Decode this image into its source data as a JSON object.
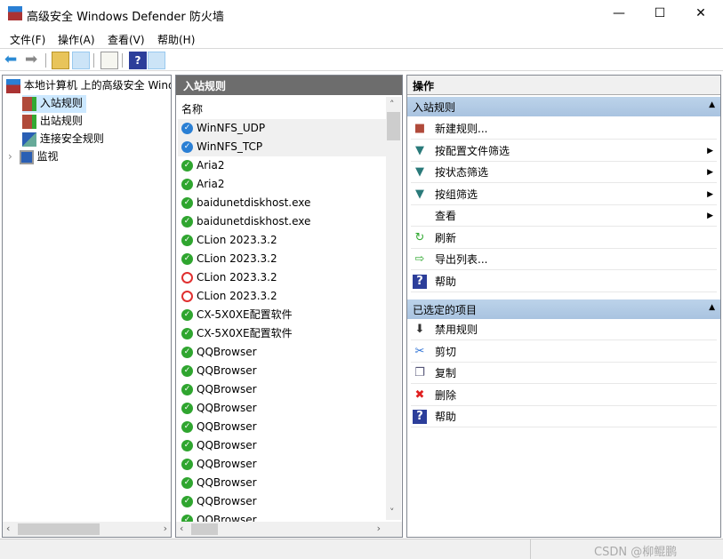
{
  "window": {
    "title": "高级安全 Windows Defender 防火墙",
    "minimize": "—",
    "maximize": "☐",
    "close": "✕"
  },
  "menu": [
    "文件(F)",
    "操作(A)",
    "查看(V)",
    "帮助(H)"
  ],
  "tree": {
    "root": "本地计算机 上的高级安全 Windows Defender 防火墙",
    "items": [
      "入站规则",
      "出站规则",
      "连接安全规则",
      "监视"
    ]
  },
  "middle": {
    "title": "入站规则",
    "column": "名称",
    "rows": [
      {
        "name": "WinNFS_UDP",
        "status": "enabled-shared"
      },
      {
        "name": "WinNFS_TCP",
        "status": "enabled-shared"
      },
      {
        "name": "Aria2",
        "status": "allow"
      },
      {
        "name": "Aria2",
        "status": "allow"
      },
      {
        "name": "baidunetdiskhost.exe",
        "status": "allow"
      },
      {
        "name": "baidunetdiskhost.exe",
        "status": "allow"
      },
      {
        "name": "CLion 2023.3.2",
        "status": "allow"
      },
      {
        "name": "CLion 2023.3.2",
        "status": "allow"
      },
      {
        "name": "CLion 2023.3.2",
        "status": "block"
      },
      {
        "name": "CLion 2023.3.2",
        "status": "block"
      },
      {
        "name": "CX-5X0XE配置软件",
        "status": "allow"
      },
      {
        "name": "CX-5X0XE配置软件",
        "status": "allow"
      },
      {
        "name": "QQBrowser",
        "status": "allow"
      },
      {
        "name": "QQBrowser",
        "status": "allow"
      },
      {
        "name": "QQBrowser",
        "status": "allow"
      },
      {
        "name": "QQBrowser",
        "status": "allow"
      },
      {
        "name": "QQBrowser",
        "status": "allow"
      },
      {
        "name": "QQBrowser",
        "status": "allow"
      },
      {
        "name": "QQBrowser",
        "status": "allow"
      },
      {
        "name": "QQBrowser",
        "status": "allow"
      },
      {
        "name": "QQBrowser",
        "status": "allow"
      },
      {
        "name": "QQBrowser",
        "status": "allow"
      }
    ]
  },
  "actions": {
    "title": "操作",
    "section1": {
      "title": "入站规则",
      "items": [
        {
          "label": "新建规则...",
          "icon": "new-rule-icon",
          "sub": false
        },
        {
          "label": "按配置文件筛选",
          "icon": "filter-icon",
          "sub": true
        },
        {
          "label": "按状态筛选",
          "icon": "filter-icon",
          "sub": true
        },
        {
          "label": "按组筛选",
          "icon": "filter-icon",
          "sub": true
        },
        {
          "label": "查看",
          "icon": "",
          "sub": true
        },
        {
          "label": "刷新",
          "icon": "refresh-icon",
          "sub": false
        },
        {
          "label": "导出列表...",
          "icon": "export-icon",
          "sub": false
        },
        {
          "label": "帮助",
          "icon": "help-icon",
          "sub": false
        }
      ]
    },
    "section2": {
      "title": "已选定的项目",
      "items": [
        {
          "label": "禁用规则",
          "icon": "disable-icon"
        },
        {
          "label": "剪切",
          "icon": "cut-icon"
        },
        {
          "label": "复制",
          "icon": "copy-icon"
        },
        {
          "label": "删除",
          "icon": "delete-icon"
        },
        {
          "label": "帮助",
          "icon": "help-icon"
        }
      ]
    }
  },
  "watermark": "CSDN @柳鲲鹏"
}
